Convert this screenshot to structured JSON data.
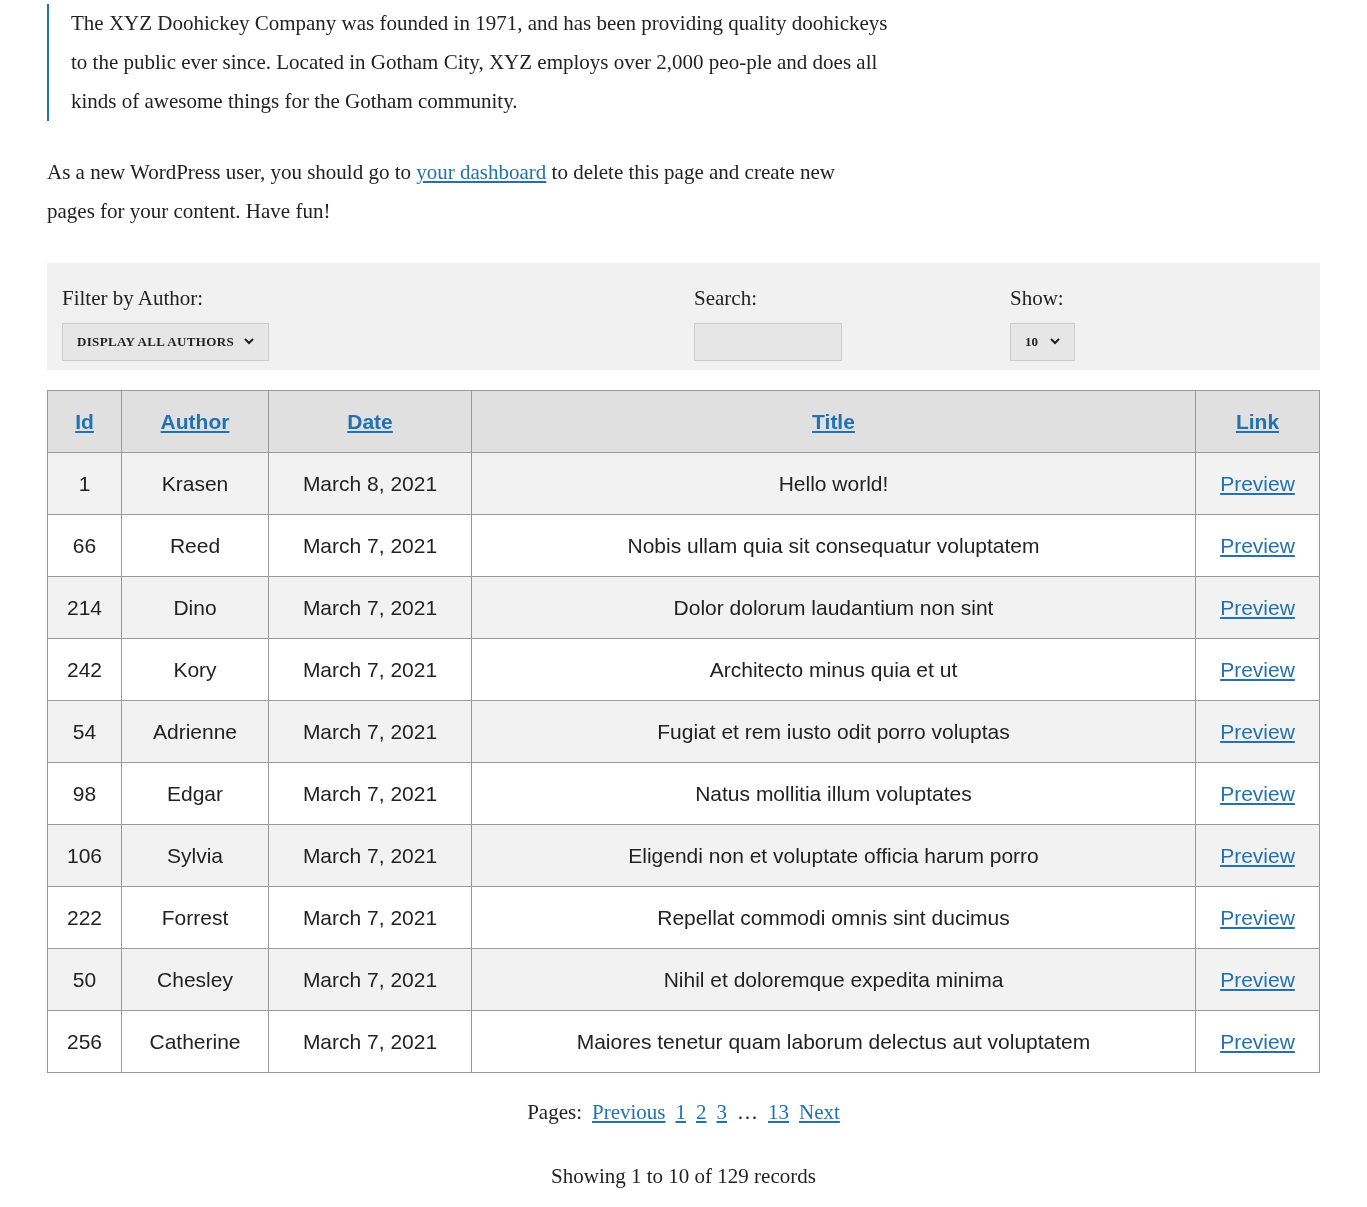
{
  "quote": "The XYZ Doohickey Company was founded in 1971, and has been providing quality doohickeys to the public ever since. Located in Gotham City, XYZ employs over 2,000 peo-ple and does all kinds of awesome things for the Gotham community.",
  "intro": {
    "before": "As a new WordPress user, you should go to",
    "link": "your dashboard",
    "after": "to delete this page and create new pages for your content. Have fun!"
  },
  "filters": {
    "author_label": "Filter by Author:",
    "author_value": "DISPLAY ALL AUTHORS",
    "search_label": "Search:",
    "show_label": "Show:",
    "show_value": "10"
  },
  "table": {
    "columns": [
      "Id",
      "Author",
      "Date",
      "Title",
      "Link"
    ],
    "rows": [
      {
        "id": "1",
        "author": "Krasen",
        "date": "March 8, 2021",
        "title": "Hello world!",
        "link": "Preview"
      },
      {
        "id": "66",
        "author": "Reed",
        "date": "March 7, 2021",
        "title": "Nobis ullam quia sit consequatur voluptatem",
        "link": "Preview"
      },
      {
        "id": "214",
        "author": "Dino",
        "date": "March 7, 2021",
        "title": "Dolor dolorum laudantium non sint",
        "link": "Preview"
      },
      {
        "id": "242",
        "author": "Kory",
        "date": "March 7, 2021",
        "title": "Architecto minus quia et ut",
        "link": "Preview"
      },
      {
        "id": "54",
        "author": "Adrienne",
        "date": "March 7, 2021",
        "title": "Fugiat et rem iusto odit porro voluptas",
        "link": "Preview"
      },
      {
        "id": "98",
        "author": "Edgar",
        "date": "March 7, 2021",
        "title": "Natus mollitia illum voluptates",
        "link": "Preview"
      },
      {
        "id": "106",
        "author": "Sylvia",
        "date": "March 7, 2021",
        "title": "Eligendi non et voluptate officia harum porro",
        "link": "Preview"
      },
      {
        "id": "222",
        "author": "Forrest",
        "date": "March 7, 2021",
        "title": "Repellat commodi omnis sint ducimus",
        "link": "Preview"
      },
      {
        "id": "50",
        "author": "Chesley",
        "date": "March 7, 2021",
        "title": "Nihil et doloremque expedita minima",
        "link": "Preview"
      },
      {
        "id": "256",
        "author": "Catherine",
        "date": "March 7, 2021",
        "title": "Maiores tenetur quam laborum delectus aut voluptatem",
        "link": "Preview"
      }
    ]
  },
  "pagination": {
    "label": "Pages:",
    "previous": "Previous",
    "pages": [
      "1",
      "2",
      "3"
    ],
    "ellipsis": "…",
    "last": "13",
    "next": "Next"
  },
  "summary": "Showing 1 to 10 of 129 records"
}
